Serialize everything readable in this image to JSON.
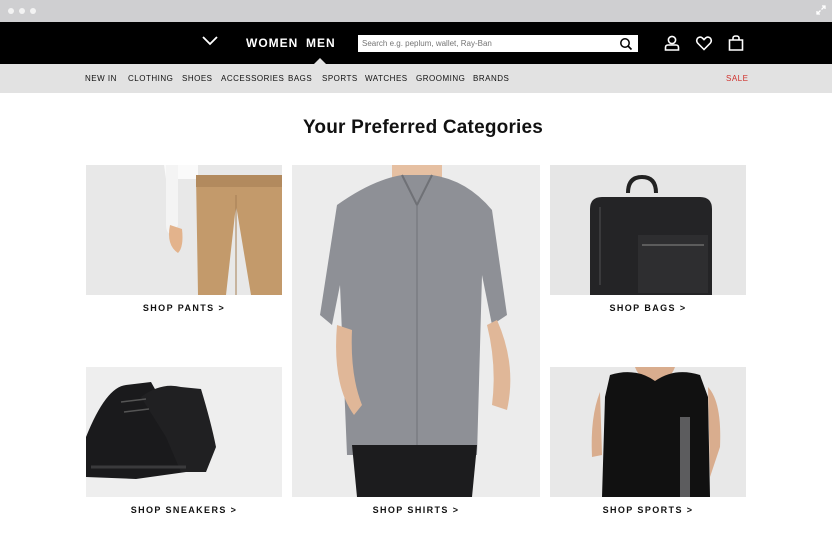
{
  "nav": {
    "women": "WOMEN",
    "men": "MEN",
    "search_placeholder": "Search e.g. peplum, wallet, Ray-Ban"
  },
  "subnav": {
    "items": [
      "NEW IN",
      "CLOTHING",
      "SHOES",
      "ACCESSORIES",
      "BAGS",
      "SPORTS",
      "WATCHES",
      "GROOMING",
      "BRANDS"
    ],
    "sale": "SALE"
  },
  "heading": "Your Preferred Categories",
  "categories": {
    "pants": "SHOP PANTS >",
    "shirts": "SHOP SHIRTS >",
    "bags": "SHOP BAGS >",
    "sneakers": "SHOP SNEAKERS >",
    "sports": "SHOP SPORTS >"
  },
  "colors": {
    "sale": "#d0312d",
    "topbar": "#000000",
    "subnav": "#e2e2e2"
  },
  "icons": [
    "menu-chevron-icon",
    "search-icon",
    "account-icon",
    "wishlist-heart-icon",
    "shopping-bag-icon",
    "expand-icon"
  ]
}
